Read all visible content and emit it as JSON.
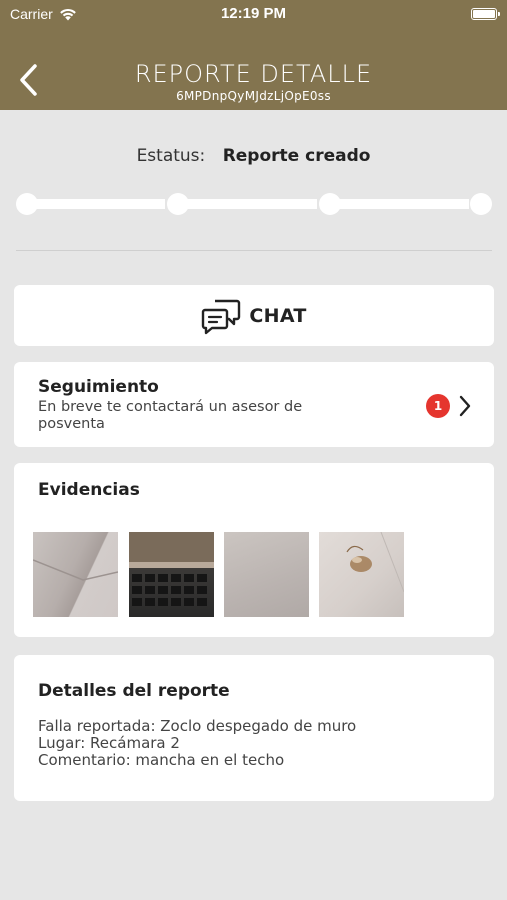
{
  "status_bar": {
    "carrier": "Carrier",
    "time": "12:19 PM"
  },
  "nav": {
    "title": "REPORTE DETALLE",
    "subtitle": "6MPDnpQyMJdzLjOpE0ss",
    "back_icon": "chevron-left-icon"
  },
  "status": {
    "label": "Estatus:",
    "value": "Reporte creado",
    "steps_total": 4,
    "steps_completed": 0
  },
  "chat": {
    "label": "CHAT",
    "icon": "chat-bubbles-icon"
  },
  "seguimiento": {
    "title": "Seguimiento",
    "text": "En breve te contactará un asesor de posventa",
    "badge": "1",
    "chevron_icon": "chevron-right-icon"
  },
  "evidencias": {
    "title": "Evidencias",
    "photos": [
      "wall-corner-photo",
      "laptop-keyboard-photo",
      "wall-photo",
      "ceiling-stain-photo"
    ]
  },
  "detalles": {
    "title": "Detalles del reporte",
    "lines": [
      "Falla reportada: Zoclo despegado de muro",
      "Lugar: Recámara 2",
      "Comentario: mancha en el techo"
    ]
  },
  "colors": {
    "header": "#83744f",
    "background": "#e6e6e6",
    "badge": "#e5352e"
  }
}
